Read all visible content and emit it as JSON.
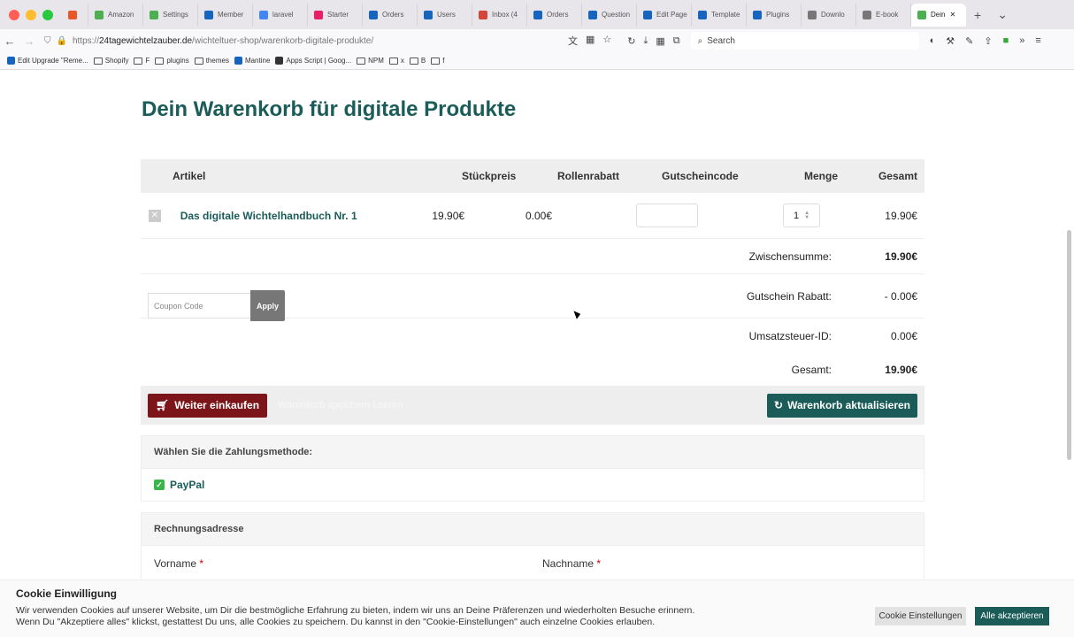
{
  "browser": {
    "tabs": [
      {
        "label": "",
        "color": "#e8572a"
      },
      {
        "label": "Amazon",
        "color": "#4caf50"
      },
      {
        "label": "Settings",
        "color": "#4caf50"
      },
      {
        "label": "Member",
        "color": "#1565c0"
      },
      {
        "label": "laravel",
        "color": "#4285f4"
      },
      {
        "label": "Starter",
        "color": "#e91e63"
      },
      {
        "label": "Orders",
        "color": "#1565c0"
      },
      {
        "label": "Users",
        "color": "#1565c0"
      },
      {
        "label": "Inbox (4",
        "color": "#d44638"
      },
      {
        "label": "Orders",
        "color": "#1565c0"
      },
      {
        "label": "Question",
        "color": "#1565c0"
      },
      {
        "label": "Edit Page",
        "color": "#1565c0"
      },
      {
        "label": "Template",
        "color": "#1565c0"
      },
      {
        "label": "Plugins",
        "color": "#1565c0"
      },
      {
        "label": "Downlo",
        "color": "#777777"
      },
      {
        "label": "E-book",
        "color": "#777777"
      },
      {
        "label": "Dein",
        "color": "#4caf50",
        "active": true
      }
    ],
    "url_prefix": "https://",
    "url_domain": "24tagewichtelzauber.de",
    "url_path": "/wichteltuer-shop/warenkorb-digitale-produkte/",
    "search_placeholder": "Search",
    "bookmarks": [
      {
        "label": "Edit Upgrade \"Reme...",
        "color": "#1565c0"
      },
      {
        "label": "Shopify",
        "color": "folder"
      },
      {
        "label": "F",
        "color": "folder"
      },
      {
        "label": "plugins",
        "color": "folder"
      },
      {
        "label": "themes",
        "color": "folder"
      },
      {
        "label": "Mantine",
        "color": "#1565c0"
      },
      {
        "label": "Apps Script | Goog...",
        "color": "#333333"
      },
      {
        "label": "NPM",
        "color": "folder"
      },
      {
        "label": "x",
        "color": "folder"
      },
      {
        "label": "B",
        "color": "folder"
      },
      {
        "label": "f",
        "color": "folder"
      }
    ]
  },
  "page": {
    "title": "Dein Warenkorb für digitale Produkte",
    "table": {
      "headers": {
        "artikel": "Artikel",
        "price": "Stückpreis",
        "rabatt": "Rollenrabatt",
        "code": "Gutscheincode",
        "menge": "Menge",
        "gesamt": "Gesamt"
      },
      "rows": [
        {
          "name": "Das digitale Wichtelhandbuch Nr. 1",
          "price": "19.90€",
          "rabatt": "0.00€",
          "qty": "1",
          "total": "19.90€"
        }
      ]
    },
    "coupon": {
      "placeholder": "Coupon Code",
      "apply": "Apply"
    },
    "summary": [
      {
        "label": "Zwischensumme:",
        "value": "19.90€",
        "bold": true
      },
      {
        "label": "Gutschein Rabatt:",
        "value": "- 0.00€"
      },
      {
        "label": "Umsatzsteuer-ID:",
        "value": "0.00€"
      },
      {
        "label": "Gesamt:",
        "value": "19.90€",
        "bold": true
      }
    ],
    "actions": {
      "continue": "Weiter einkaufen",
      "ghost": "Warenkorb speichern  Leeren",
      "update": "Warenkorb aktualisieren"
    },
    "payment": {
      "heading": "Wählen Sie die Zahlungsmethode:",
      "option": "PayPal"
    },
    "billing": {
      "heading": "Rechnungsadresse",
      "first": "Vorname",
      "last": "Nachname",
      "required_mark": "*"
    }
  },
  "cookie": {
    "title": "Cookie Einwilligung",
    "text1": "Wir verwenden Cookies auf unserer Website, um Dir die bestmögliche Erfahrung zu bieten, indem wir uns an Deine Präferenzen und wiederholten Besuche erinnern.",
    "text2": "Wenn Du \"Akzeptiere alles\" klickst, gestattest Du uns, alle Cookies zu speichern. Du kannst in den \"Cookie-Einstellungen\" auch einzelne Cookies erlauben.",
    "settings_button": "Cookie Einstellungen",
    "accept_button": "Alle akzeptieren"
  }
}
